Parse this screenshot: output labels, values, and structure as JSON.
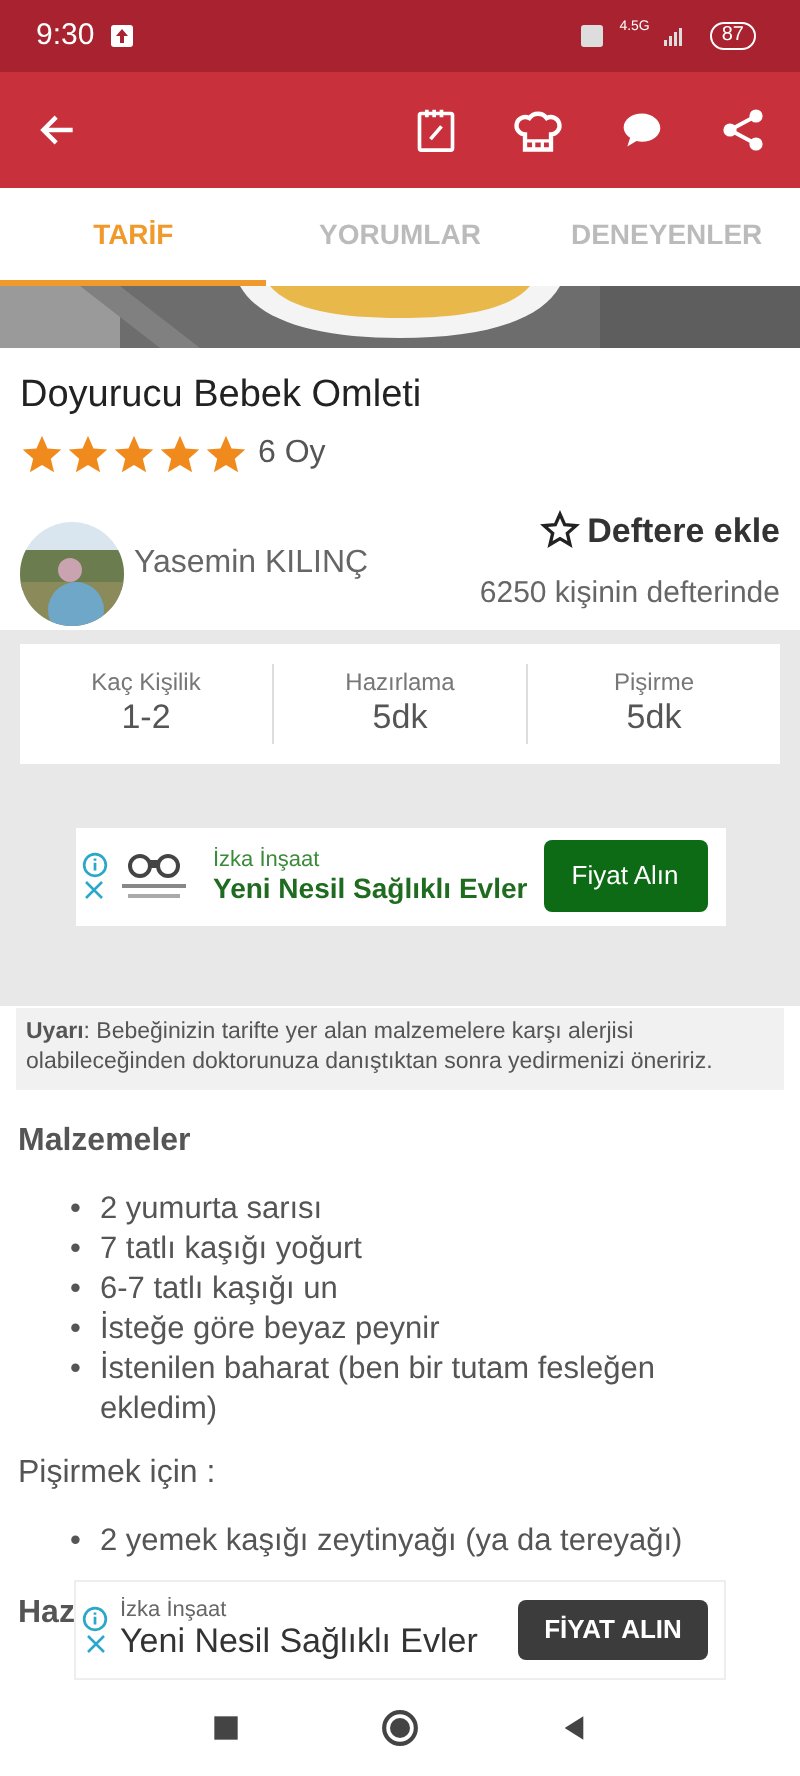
{
  "status_bar": {
    "time": "9:30",
    "battery": "87",
    "network": "4.5G"
  },
  "tabs": [
    {
      "label": "TARİF",
      "selected": true
    },
    {
      "label": "YORUMLAR",
      "selected": false
    },
    {
      "label": "DENEYENLER",
      "selected": false
    }
  ],
  "recipe": {
    "title": "Doyurucu Bebek Omleti",
    "stars": 5,
    "votes": "6 Oy"
  },
  "author": {
    "name": "Yasemin KILINÇ",
    "notebook_button": "Deftere ekle",
    "notebook_count": "6250 kişinin defterinde"
  },
  "info": [
    {
      "label": "Kaç Kişilik",
      "value": "1-2"
    },
    {
      "label": "Hazırlama",
      "value": "5dk"
    },
    {
      "label": "Pişirme",
      "value": "5dk"
    }
  ],
  "ads": [
    {
      "advertiser": "İzka İnşaat",
      "headline": "Yeni Nesil Sağlıklı Evler",
      "button": "Fiyat Alın",
      "kind": "inline"
    },
    {
      "advertiser": "İzka İnşaat",
      "headline": "Yeni Nesil Sağlıklı Evler",
      "button": "FİYAT ALIN",
      "kind": "banner"
    }
  ],
  "warning": "**Uyarı**: Bebeğinizin tarifte yer alan malzemelere karşı alerjisi olabileceğinden doktorunuza danıştıktan sonra yedirmenizi öneririz.",
  "sections": [
    {
      "heading": "Malzemeler",
      "kind": "heading",
      "marker": "•",
      "items": [
        "2 yumurta sarısı",
        "7 tatlı kaşığı yoğurt",
        "6-7 tatlı kaşığı un",
        "İsteğe göre beyaz peynir",
        "İstenilen baharat (ben bir tutam fesleğen ekledim)"
      ]
    },
    {
      "heading": "Pişirmek için :",
      "kind": "subheading",
      "marker": "•",
      "items": [
        "2 yemek kaşığı zeytinyağı (ya da tereyağı)"
      ]
    },
    {
      "heading": "Haz",
      "kind": "heading"
    }
  ]
}
